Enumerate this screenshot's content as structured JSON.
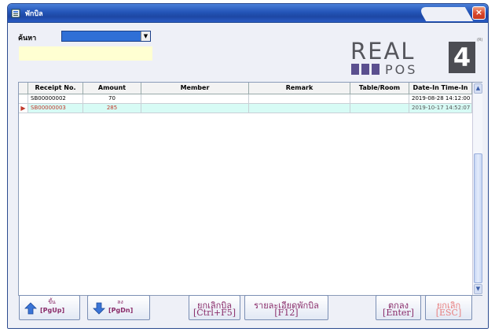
{
  "window": {
    "title": "พักบิล",
    "close_label": "×"
  },
  "search": {
    "label": "ค้นหา",
    "selected_value": ""
  },
  "logo": {
    "text_real": "REAL",
    "text_pos": "POS",
    "text_4": "4",
    "tm": "(R)"
  },
  "table": {
    "columns": [
      "Receipt No.",
      "Amount",
      "Member",
      "Remark",
      "Table/Room",
      "Date-In Time-In"
    ],
    "rows": [
      {
        "receipt": "SB00000002",
        "amount": "70",
        "member": "",
        "remark": "",
        "table_room": "",
        "date_in": "2019-08-28  14:12:00"
      },
      {
        "receipt": "SB00000003",
        "amount": "285",
        "member": "",
        "remark": "",
        "table_room": "",
        "date_in": "2019-10-17  14:52:07"
      }
    ],
    "current_row_marker": "▶"
  },
  "buttons": {
    "page_up": {
      "line1": "ขึ้น",
      "line2": "[PgUp]"
    },
    "page_down": {
      "line1": "ลง",
      "line2": "[PgDn]"
    },
    "cancel_bill": {
      "line1": "ยกเลิกบิล",
      "line2": "[Ctrl+F5]"
    },
    "bill_detail": {
      "line1": "รายละเอียดพักบิล",
      "line2": "[F12]"
    },
    "ok": {
      "line1": "ตกลง",
      "line2": "[Enter]"
    },
    "cancel": {
      "line1": "ยกเลิก",
      "line2": "[ESC]"
    }
  },
  "colors": {
    "titlebar": "#2455b8",
    "highlight_row": "#d7fbf5",
    "button_text": "#8a2c6a",
    "logo_purple": "#5a4f8f"
  }
}
